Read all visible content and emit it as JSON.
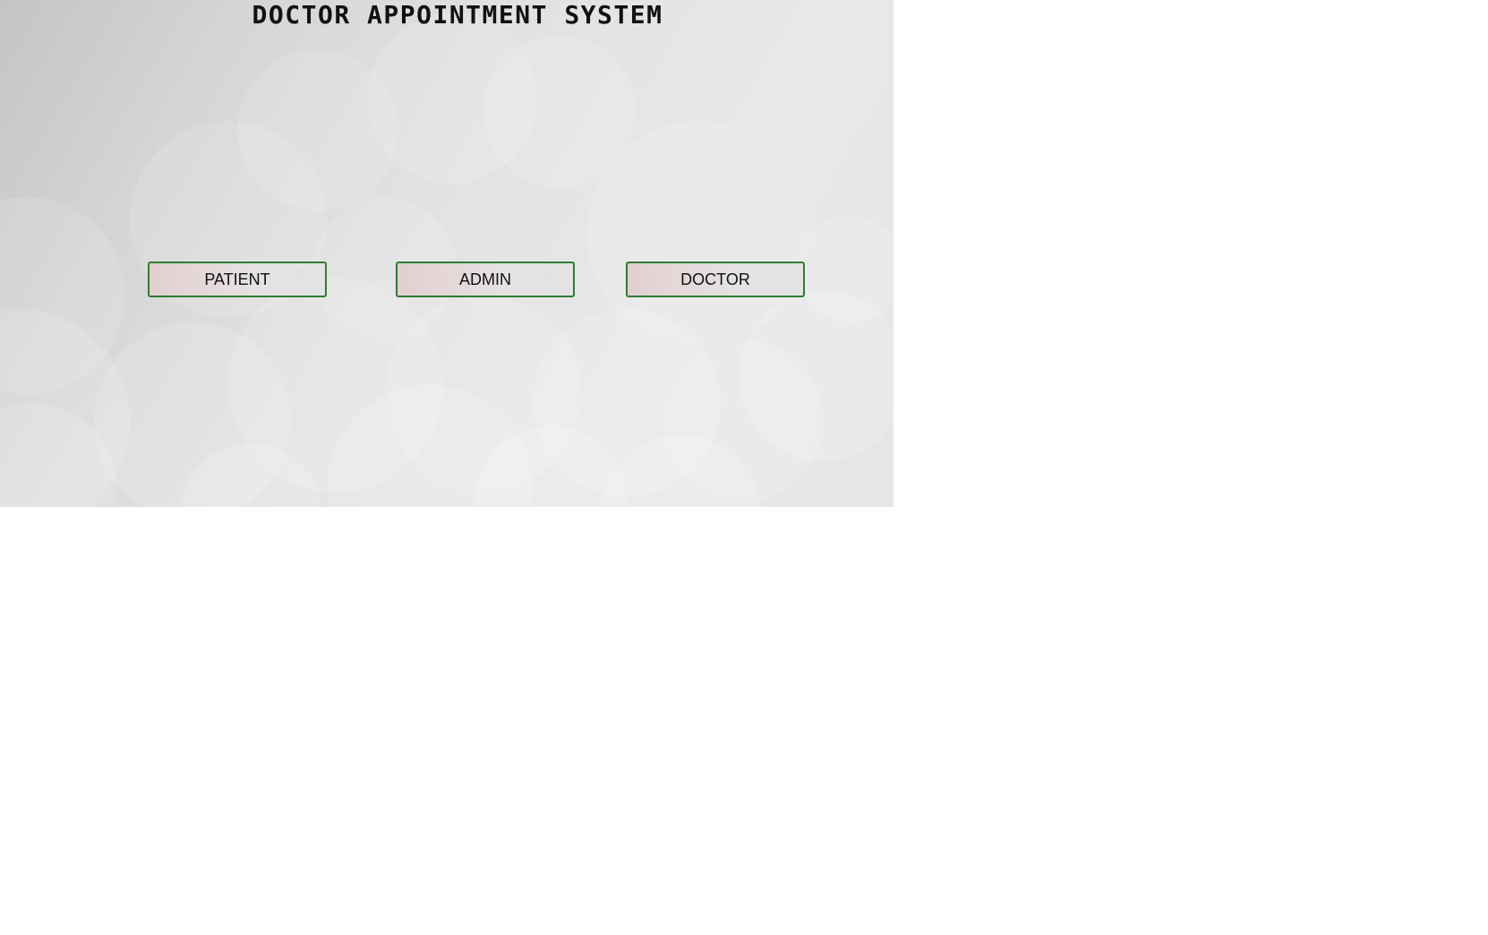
{
  "page": {
    "title": "DOCTOR APPOINTMENT SYSTEM"
  },
  "buttons": {
    "patient": "PATIENT",
    "admin": "ADMIN",
    "doctor": "DOCTOR"
  },
  "colors": {
    "page_background": "#ffffff",
    "panel_background": "#e0e0e0",
    "button_border": "#2e7d32",
    "button_tint": "#e2cfd0",
    "title_text": "#111111"
  }
}
